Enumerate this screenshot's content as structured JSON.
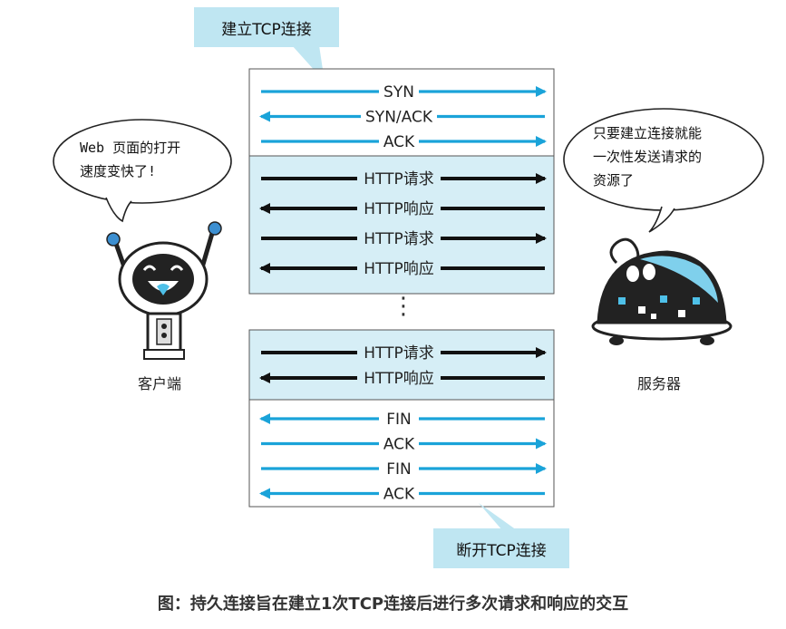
{
  "callouts": {
    "establish": "建立TCP连接",
    "close": "断开TCP连接"
  },
  "client": {
    "label": "客户端",
    "speech": [
      "Web 页面的打开",
      "速度变快了!"
    ]
  },
  "server": {
    "label": "服务器",
    "speech": [
      "只要建立连接就能",
      "一次性发送请求的",
      "资源了"
    ]
  },
  "sections": [
    {
      "id": "handshake",
      "color": "#ffffff",
      "messages": [
        {
          "label": "SYN",
          "dir": "right",
          "style": "tcp"
        },
        {
          "label": "SYN/ACK",
          "dir": "left",
          "style": "tcp"
        },
        {
          "label": "ACK",
          "dir": "right",
          "style": "tcp"
        }
      ]
    },
    {
      "id": "http1",
      "color": "#d6eef6",
      "messages": [
        {
          "label": "HTTP请求",
          "dir": "right",
          "style": "http"
        },
        {
          "label": "HTTP响应",
          "dir": "left",
          "style": "http"
        },
        {
          "label": "HTTP请求",
          "dir": "right",
          "style": "http"
        },
        {
          "label": "HTTP响应",
          "dir": "left",
          "style": "http"
        }
      ]
    },
    {
      "id": "http2",
      "color": "#d6eef6",
      "messages": [
        {
          "label": "HTTP请求",
          "dir": "right",
          "style": "http"
        },
        {
          "label": "HTTP响应",
          "dir": "left",
          "style": "http"
        }
      ]
    },
    {
      "id": "teardown",
      "color": "#ffffff",
      "messages": [
        {
          "label": "FIN",
          "dir": "left",
          "style": "tcp"
        },
        {
          "label": "ACK",
          "dir": "right",
          "style": "tcp"
        },
        {
          "label": "FIN",
          "dir": "right",
          "style": "tcp"
        },
        {
          "label": "ACK",
          "dir": "left",
          "style": "tcp"
        }
      ]
    }
  ],
  "ellipsis": "⋮",
  "caption": "图：持久连接旨在建立1次TCP连接后进行多次请求和响应的交互",
  "colors": {
    "tcp": "#1aa3d9",
    "http": "#111111",
    "box_border": "#555555",
    "callout": "#bfe6f2"
  }
}
